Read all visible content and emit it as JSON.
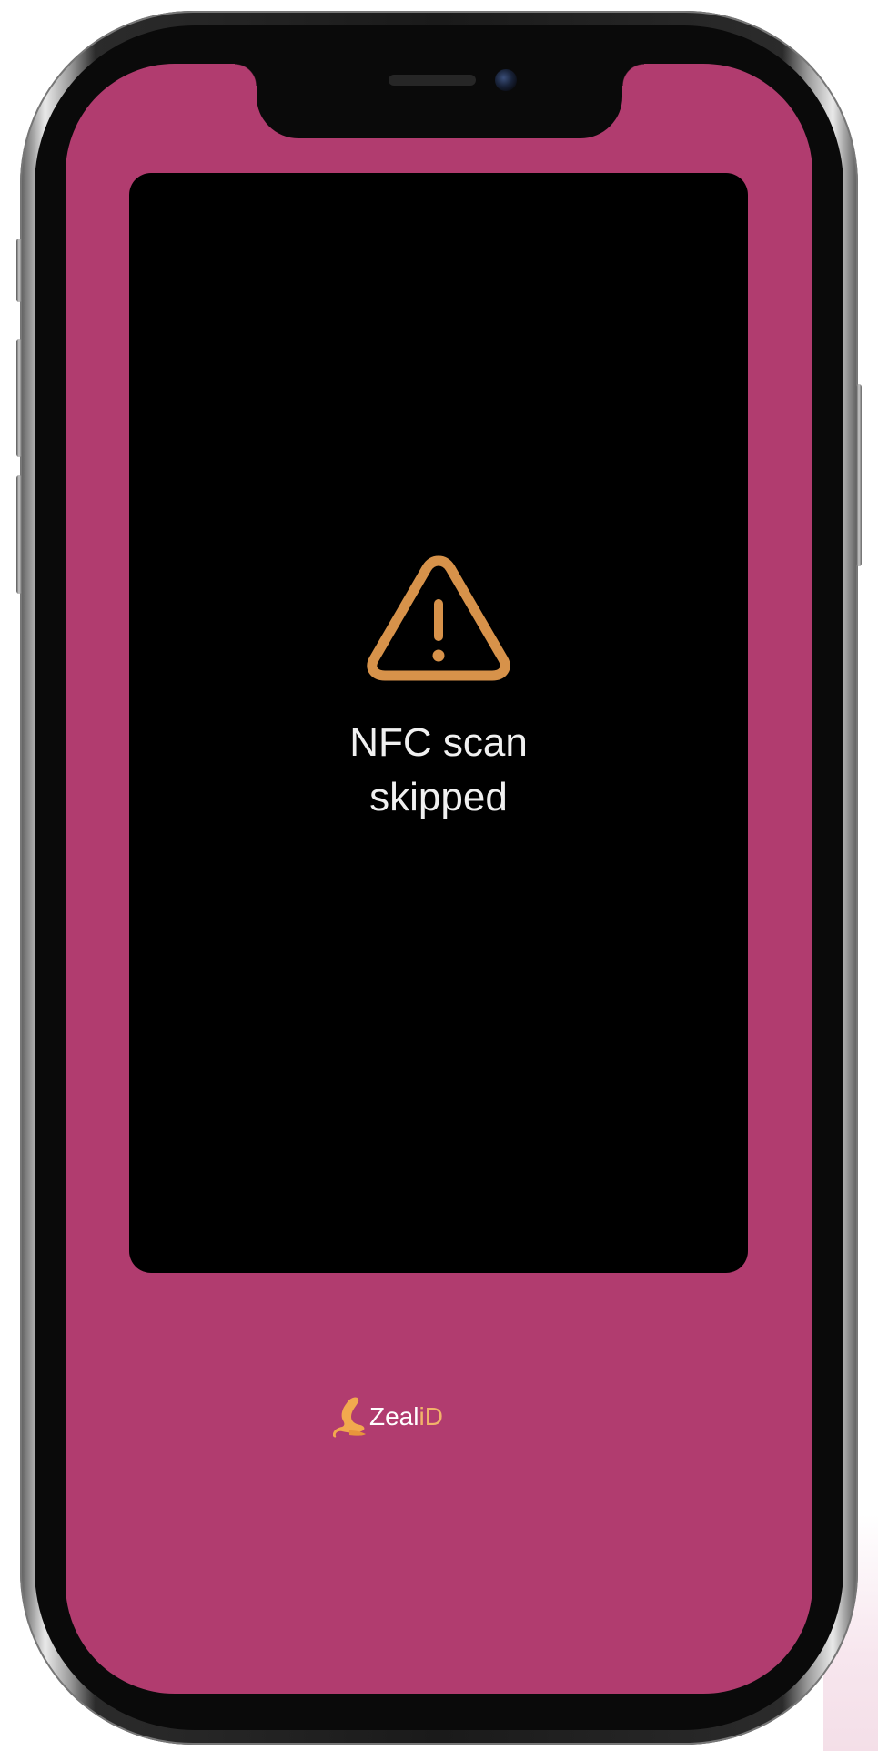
{
  "colors": {
    "screen_background": "#b13c6f",
    "panel_background": "#000000",
    "warning_accent": "#d7924a",
    "text_primary": "#f0f0f0",
    "brand_accent": "#f2b36a"
  },
  "status": {
    "icon": "warning-triangle-icon",
    "line1": "NFC scan",
    "line2": "skipped"
  },
  "brand": {
    "logo_icon": "zealid-seal-logo-icon",
    "name_prefix": "Zeal",
    "name_suffix": "iD"
  }
}
